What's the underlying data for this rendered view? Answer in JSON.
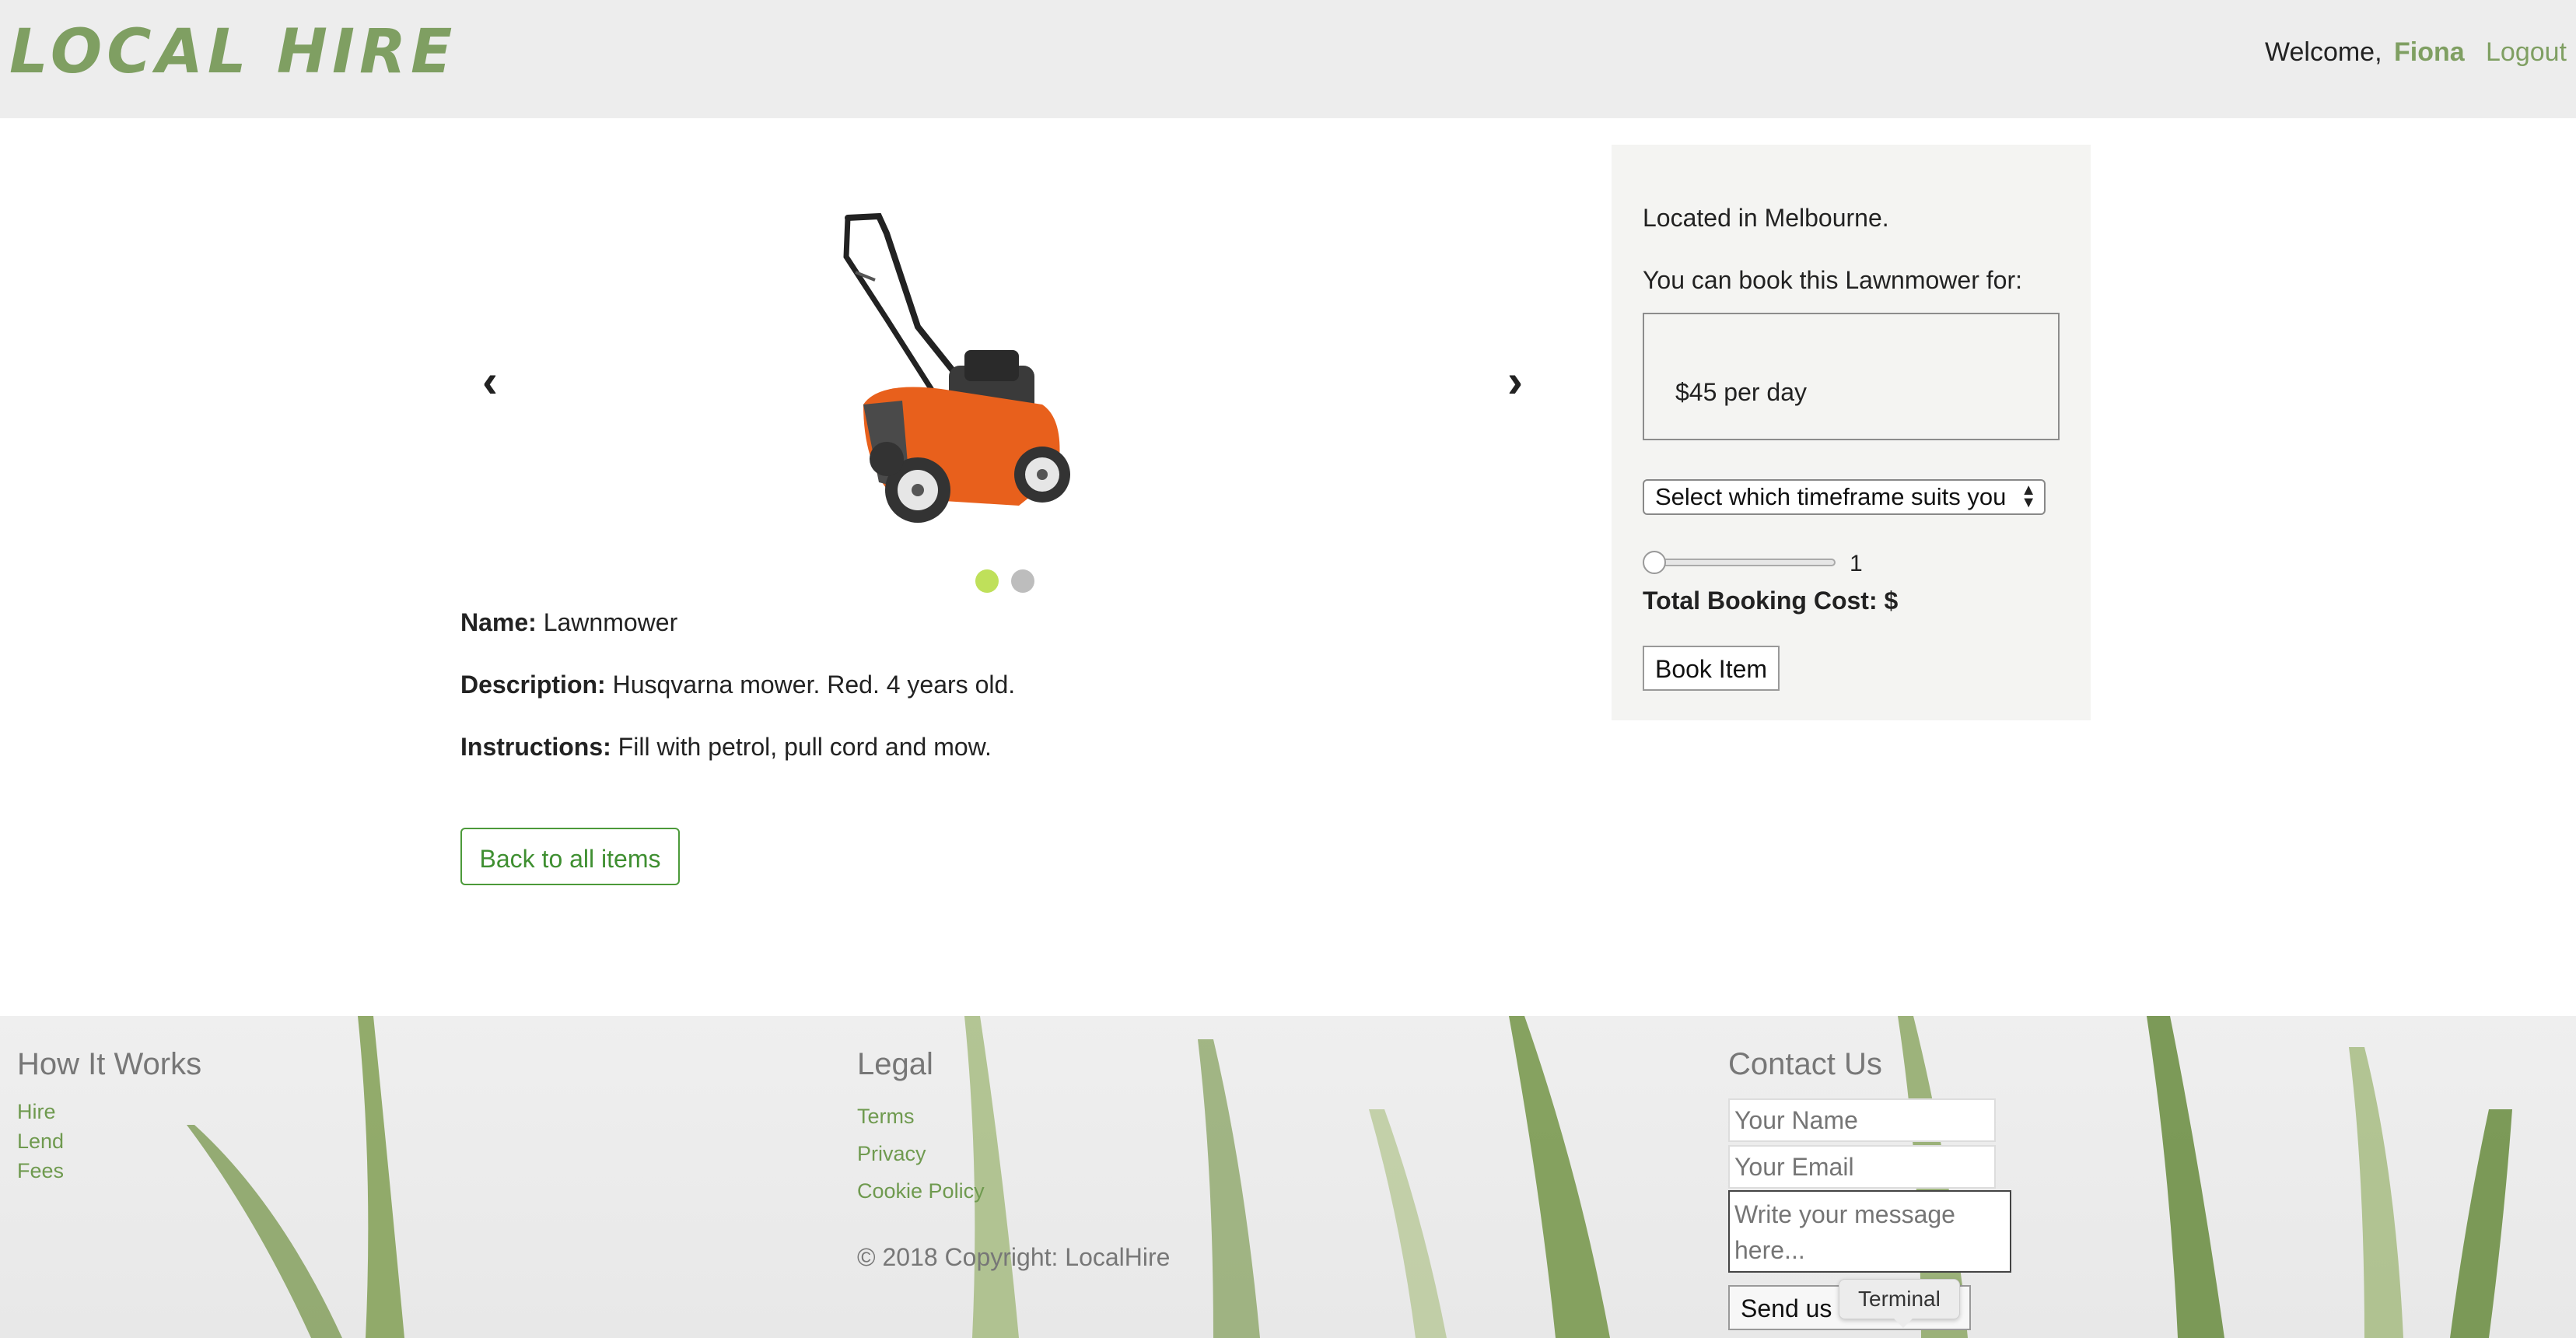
{
  "header": {
    "logo": "LOCAL HIRE",
    "welcome": "Welcome,",
    "user_name": "Fiona",
    "logout": "Logout"
  },
  "carousel": {
    "prev": "‹",
    "next": "›",
    "image_icon": "lawnmower-image",
    "dots": 2,
    "active_dot": 1
  },
  "item": {
    "name_label": "Name:",
    "name": "Lawnmower",
    "description_label": "Description:",
    "description": "Husqvarna mower. Red. 4 years old.",
    "instructions_label": "Instructions:",
    "instructions": "Fill with petrol, pull cord and mow.",
    "back_button": "Back to all items"
  },
  "booking": {
    "location": "Located in Melbourne.",
    "prompt": "You can book this Lawnmower for:",
    "price": "$45 per day",
    "timeframe_select": "Select which timeframe suits you",
    "slider_value": "1",
    "total_cost": "Total Booking Cost: $",
    "book_button": "Book Item"
  },
  "footer": {
    "how_it_works": {
      "heading": "How It Works",
      "links": [
        "Hire",
        "Lend",
        "Fees"
      ]
    },
    "legal": {
      "heading": "Legal",
      "links": [
        "Terms",
        "Privacy",
        "Cookie Policy"
      ]
    },
    "copyright": "© 2018 Copyright: LocalHire",
    "contact": {
      "heading": "Contact Us",
      "name_placeholder": "Your Name",
      "email_placeholder": "Your Email",
      "message_placeholder": "Write your message here...",
      "send_button": "Send us"
    },
    "tooltip": "Terminal"
  },
  "colors": {
    "accent": "#7f9f62",
    "button_green": "#3f8f31",
    "dot_active": "#bfe05a",
    "dot_inactive": "#bdbdbd"
  }
}
